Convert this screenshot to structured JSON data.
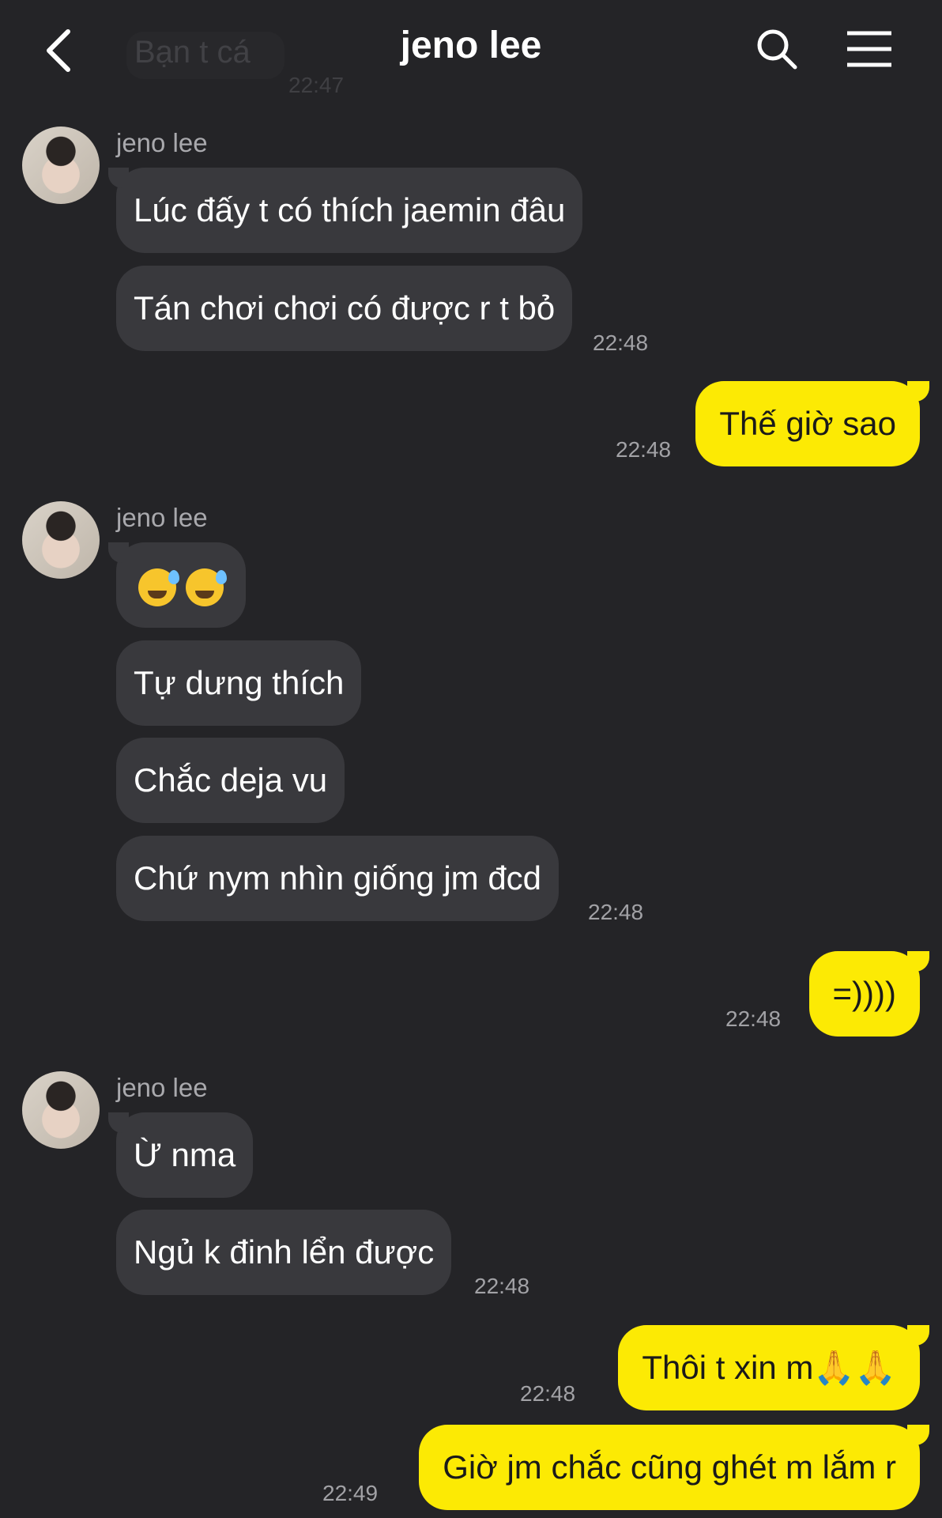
{
  "header": {
    "title": "jeno lee",
    "back_icon": "chevron-left-icon",
    "search_icon": "search-icon",
    "menu_icon": "menu-icon"
  },
  "faded_preview": {
    "text": "Bạn t cá",
    "time": "22:47"
  },
  "colors": {
    "background": "#242427",
    "incoming_bubble": "#39393d",
    "outgoing_bubble": "#fcea04"
  },
  "groups": [
    {
      "sender": "jeno lee",
      "messages": [
        "Lúc đấy t có thích jaemin đâu",
        "Tán chơi chơi có được r t bỏ"
      ],
      "time": "22:48"
    },
    {
      "outgoing": "Thế giờ sao",
      "time": "22:48"
    },
    {
      "sender": "jeno lee",
      "emoji_label": "sweat-smile-emoji x2",
      "messages": [
        "Tự dưng thích",
        "Chắc deja vu",
        "Chứ nym nhìn giống jm đcd"
      ],
      "time": "22:48"
    },
    {
      "outgoing": "=))))",
      "time": "22:48"
    },
    {
      "sender": "jeno lee",
      "messages": [
        "Ừ nma",
        "Ngủ k đinh lển được"
      ],
      "time": "22:48"
    },
    {
      "outgoing": "Thôi t xin m🙏🙏",
      "time": "22:48"
    },
    {
      "outgoing": "Giờ jm chắc cũng ghét m lắm r",
      "time": "22:49"
    }
  ]
}
